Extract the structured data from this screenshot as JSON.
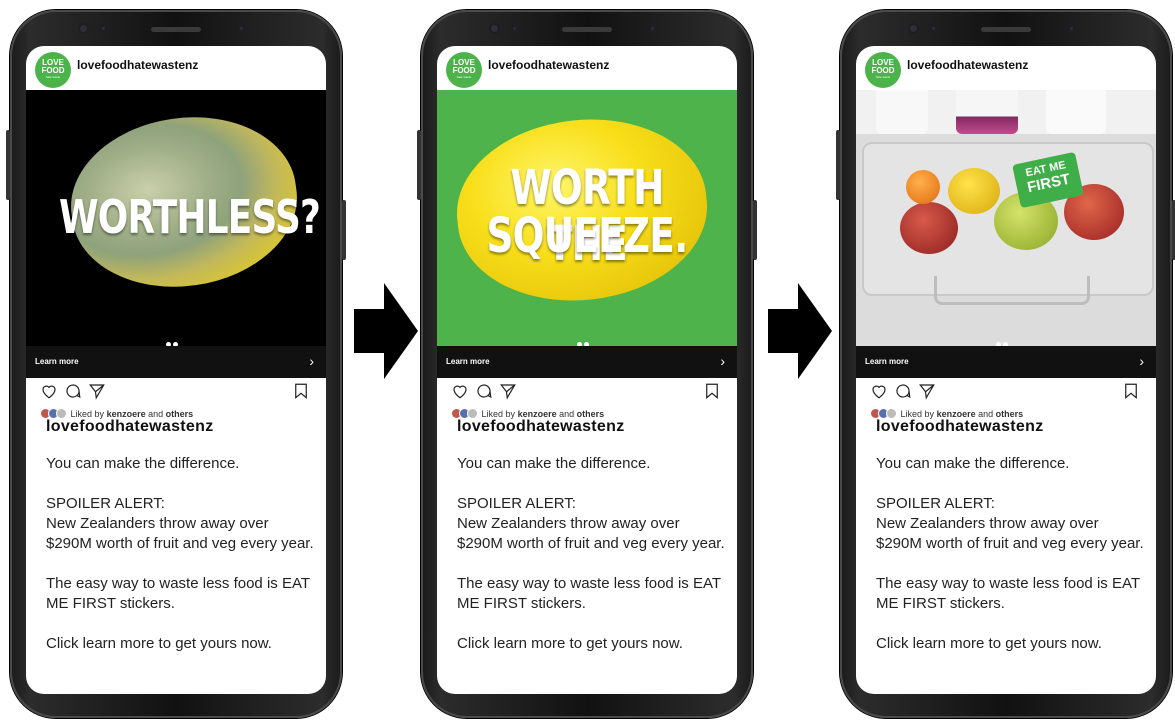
{
  "account": {
    "username": "lovefoodhatewastenz",
    "logo_line1": "LOVE",
    "logo_line2": "FOOD",
    "logo_line3": "hate waste"
  },
  "posts": [
    {
      "headline_1": "WORTHLESS?",
      "headline_2": "",
      "media_bg": "#000000"
    },
    {
      "headline_1": "WORTH THE",
      "headline_2": "SQUEEZE.",
      "media_bg": "#4db34a"
    },
    {
      "sticker_line1": "EAT ME",
      "sticker_line2": "FIRST",
      "media_bg": "#dcdcdc"
    }
  ],
  "cta": {
    "label": "Learn more",
    "chevron": "›"
  },
  "likes": {
    "prefix": "Liked by",
    "user": "kenzoere",
    "middle": "and",
    "suffix": "others"
  },
  "caption": {
    "user": "lovefoodhatewastenz",
    "line1": "You can make the difference.",
    "line2": "SPOILER ALERT:",
    "line3": "New Zealanders throw away over $290M worth of fruit and veg every year.",
    "line4": "The easy way to waste less food is EAT ME FIRST stickers.",
    "line5": "Click learn more to get yours now."
  },
  "icons": [
    "heart-icon",
    "comment-icon",
    "share-icon",
    "bookmark-icon",
    "arrow-right-icon"
  ],
  "colors": {
    "brand_green": "#4bb34a",
    "cta_bar": "#111111"
  }
}
